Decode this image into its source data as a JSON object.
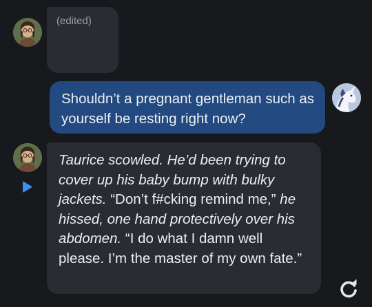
{
  "colors": {
    "background": "#18191d",
    "ai_bubble": "#2a2c33",
    "user_bubble": "#234a80",
    "text": "#eceef2",
    "muted": "#9aa0aa"
  },
  "messages": [
    {
      "sender": "character",
      "avatar_icon": "character-avatar-icon",
      "status": "(edited)"
    },
    {
      "sender": "user",
      "avatar_icon": "user-avatar-unicorn-icon",
      "text": "Shouldn’t a pregnant gentleman such as yourself be resting right now?"
    },
    {
      "sender": "character",
      "avatar_icon": "character-avatar-icon",
      "segments": [
        {
          "style": "italic",
          "text": "Taurice scowled. He’d been trying to cover up his baby bump with bulky jackets."
        },
        {
          "style": "normal",
          "text": " “Don’t f#cking remind me,”"
        },
        {
          "style": "italic",
          "text": " he hissed, one hand protectively over his abdomen."
        },
        {
          "style": "normal",
          "text": " “I do what I damn well please. I’m the master of my own fate.”"
        }
      ]
    }
  ],
  "controls": {
    "play_icon": "play-icon",
    "regenerate_icon": "regenerate-icon"
  }
}
